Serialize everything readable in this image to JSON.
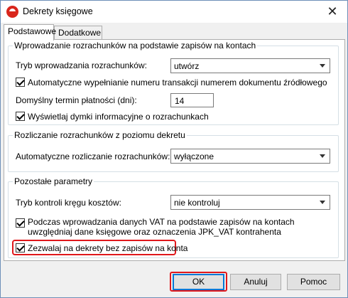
{
  "window": {
    "title": "Dekrety księgowe",
    "close_symbol": "✕",
    "accent_color": "#e0171b"
  },
  "tabs": [
    {
      "label": "Podstawowe",
      "active": true
    },
    {
      "label": "Dodatkowe",
      "active": false
    }
  ],
  "group1": {
    "legend": "Wprowadzanie rozrachunków na podstawie zapisów na kontach",
    "mode_label": "Tryb wprowadzania rozrachunków:",
    "mode_value": "utwórz",
    "auto_fill_label": "Automatyczne wypełnianie numeru transakcji numerem dokumentu źródłowego",
    "auto_fill_checked": true,
    "due_label": "Domyślny termin płatności (dni):",
    "due_value": "14",
    "tooltips_label": "Wyświetlaj dymki informacyjne o rozrachunkach",
    "tooltips_checked": true
  },
  "group2": {
    "legend": "Rozliczanie rozrachunków z poziomu dekretu",
    "auto_settle_label": "Automatyczne rozliczanie rozrachunków:",
    "auto_settle_value": "wyłączone"
  },
  "group3": {
    "legend": "Pozostałe parametry",
    "cost_control_label": "Tryb kontroli kręgu kosztów:",
    "cost_control_value": "nie kontroluj",
    "vat_label_line1": "Podczas wprowadzania danych VAT na podstawie zapisów na kontach",
    "vat_label_line2": "uwzględniaj dane księgowe oraz oznaczenia JPK_VAT kontrahenta",
    "vat_checked": true,
    "allow_empty_label": "Zezwalaj na dekrety bez zapisów na konta",
    "allow_empty_checked": true
  },
  "buttons": {
    "ok": "OK",
    "cancel": "Anuluj",
    "help": "Pomoc"
  }
}
